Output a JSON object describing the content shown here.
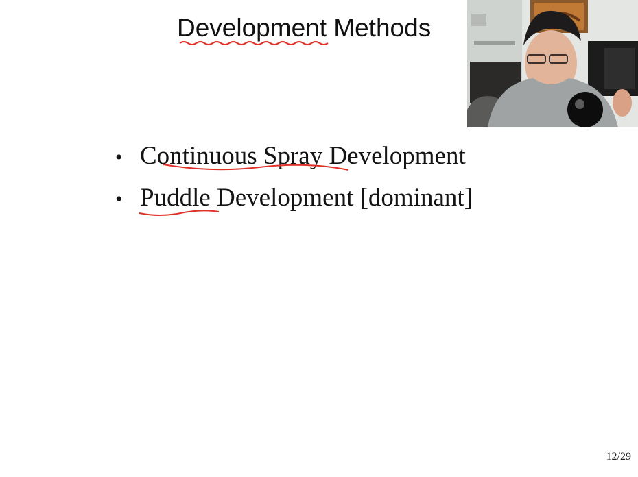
{
  "slide": {
    "title": "Development Methods",
    "bullets": [
      {
        "marker": "•",
        "text": "Continuous Spray Development"
      },
      {
        "marker": "•",
        "text": "Puddle Development [dominant]"
      }
    ],
    "page_number": "12/29"
  },
  "annotation_color": "#e0302a",
  "video_overlay": {
    "subject": "presenter-webcam"
  }
}
